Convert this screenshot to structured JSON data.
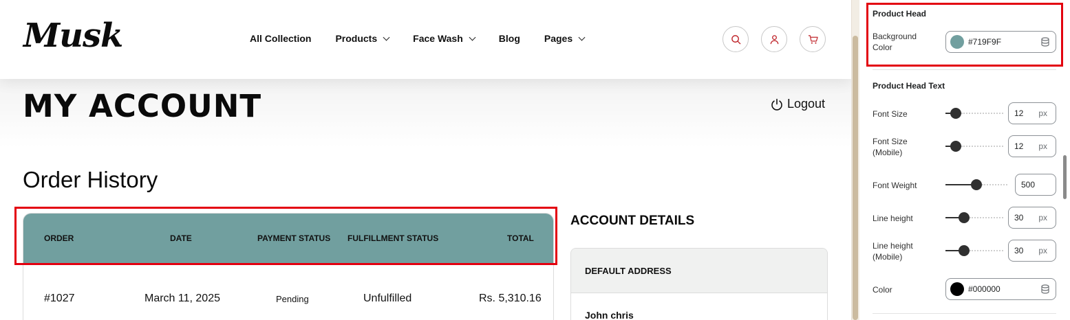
{
  "store": {
    "logo": "Musk",
    "nav": [
      {
        "label": "All Collection",
        "dropdown": false
      },
      {
        "label": "Products",
        "dropdown": true
      },
      {
        "label": "Face Wash",
        "dropdown": true
      },
      {
        "label": "Blog",
        "dropdown": false
      },
      {
        "label": "Pages",
        "dropdown": true
      }
    ],
    "header_icons": [
      "search-icon",
      "user-icon",
      "cart-icon"
    ],
    "accent_color": "#c0272d"
  },
  "account": {
    "title": "MY ACCOUNT",
    "logout_label": "Logout",
    "order_history_title": "Order History",
    "table": {
      "header_bg": "#719F9F",
      "columns": [
        "ORDER",
        "DATE",
        "PAYMENT STATUS",
        "FULFILLMENT STATUS",
        "TOTAL"
      ],
      "rows": [
        [
          "#1027",
          "March 11, 2025",
          "Pending",
          "Unfulfilled",
          "Rs. 5,310.16"
        ]
      ]
    },
    "details_title": "ACCOUNT DETAILS",
    "address": {
      "heading": "DEFAULT ADDRESS",
      "name": "John chris"
    }
  },
  "panel": {
    "product_head": {
      "title": "Product Head",
      "bg_label": "Background Color",
      "bg_value": "#719F9F",
      "bg_color": "#719F9F"
    },
    "product_head_text": {
      "title": "Product Head Text",
      "font_size": {
        "label": "Font Size",
        "value": "12",
        "unit": "px",
        "level": 0.1
      },
      "font_size_mobile": {
        "label": "Font Size (Mobile)",
        "value": "12",
        "unit": "px",
        "level": 0.1
      },
      "font_weight": {
        "label": "Font Weight",
        "value": "500",
        "level": 0.5
      },
      "line_height": {
        "label": "Line height",
        "value": "30",
        "unit": "px",
        "level": 0.28
      },
      "line_height_mobile": {
        "label": "Line height (Mobile)",
        "value": "30",
        "unit": "px",
        "level": 0.28
      },
      "color": {
        "label": "Color",
        "value": "#000000",
        "swatch": "#000000"
      }
    }
  }
}
